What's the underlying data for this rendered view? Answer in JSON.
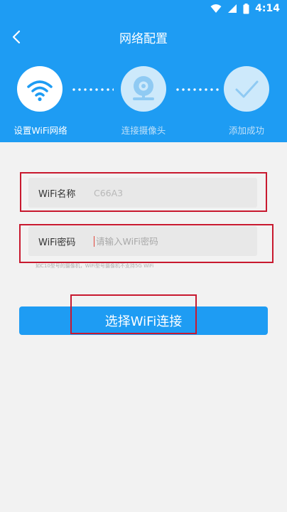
{
  "status_bar": {
    "time": "4:14",
    "icons": [
      "wifi-icon",
      "cellular-signal-icon",
      "battery-icon"
    ]
  },
  "header": {
    "title": "网络配置",
    "back_icon": "back-arrow-icon"
  },
  "steps": [
    {
      "label": "设置WiFi网络",
      "icon": "wifi-icon",
      "active": true
    },
    {
      "label": "连接摄像头",
      "icon": "camera-icon",
      "active": false
    },
    {
      "label": "添加成功",
      "icon": "checkmark-icon",
      "active": false
    }
  ],
  "form": {
    "wifi_name": {
      "label": "WiFi名称",
      "value": "C66A3"
    },
    "wifi_password": {
      "label": "WiFi密码",
      "placeholder": "请输入WiFi密码",
      "value": ""
    },
    "hint": "如C10型号的摄像机，WiFi型号摄像机不支持5G WiFi"
  },
  "actions": {
    "select_wifi_label": "选择WiFi连接"
  },
  "colors": {
    "primary": "#1e9cf3",
    "highlight_box": "#c8192f",
    "field_bg": "#e8e8e8",
    "page_bg": "#f2f2f2"
  }
}
